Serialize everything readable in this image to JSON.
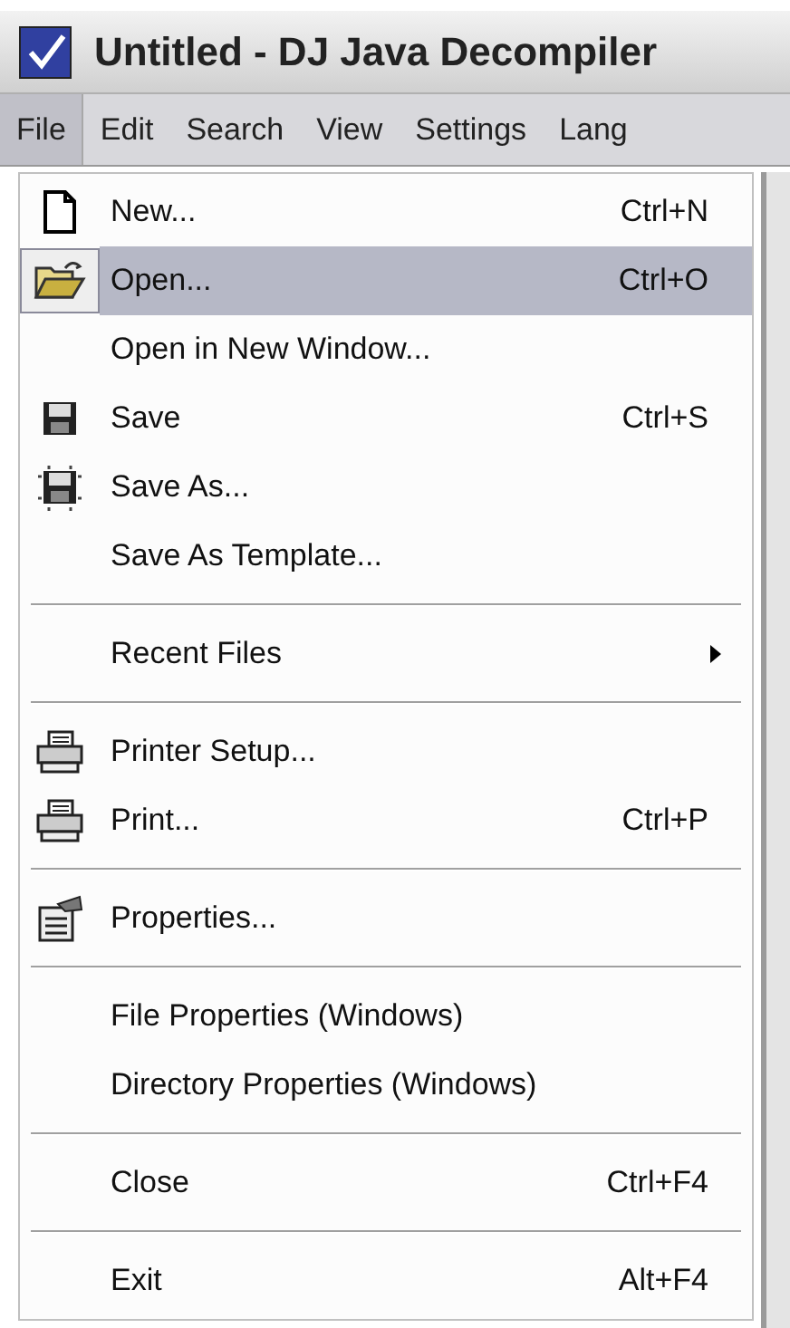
{
  "window": {
    "title": "Untitled - DJ Java Decompiler"
  },
  "menu_bar": [
    {
      "label": "File",
      "selected": true
    },
    {
      "label": "Edit",
      "selected": false
    },
    {
      "label": "Search",
      "selected": false
    },
    {
      "label": "View",
      "selected": false
    },
    {
      "label": "Settings",
      "selected": false
    },
    {
      "label": "Lang",
      "selected": false
    }
  ],
  "file_menu": [
    {
      "kind": "item",
      "label": "New...",
      "shortcut": "Ctrl+N",
      "selected": false
    },
    {
      "kind": "item",
      "label": "Open...",
      "shortcut": "Ctrl+O",
      "selected": true
    },
    {
      "kind": "item",
      "label": "Open in New Window...",
      "selected": false
    },
    {
      "kind": "item",
      "label": "Save",
      "shortcut": "Ctrl+S",
      "selected": false
    },
    {
      "kind": "item",
      "label": "Save As...",
      "selected": false
    },
    {
      "kind": "item",
      "label": "Save As Template...",
      "selected": false
    },
    {
      "kind": "separator"
    },
    {
      "kind": "submenu",
      "label": "Recent Files",
      "selected": false
    },
    {
      "kind": "separator"
    },
    {
      "kind": "item",
      "label": "Printer Setup...",
      "selected": false
    },
    {
      "kind": "item",
      "label": "Print...",
      "shortcut": "Ctrl+P",
      "selected": false
    },
    {
      "kind": "separator"
    },
    {
      "kind": "item",
      "label": "Properties...",
      "selected": false
    },
    {
      "kind": "separator"
    },
    {
      "kind": "item",
      "label": "File Properties (Windows)",
      "selected": false
    },
    {
      "kind": "item",
      "label": "Directory Properties (Windows)",
      "selected": false
    },
    {
      "kind": "separator"
    },
    {
      "kind": "item",
      "label": "Close",
      "shortcut": "Ctrl+F4",
      "selected": false
    },
    {
      "kind": "separator"
    },
    {
      "kind": "item",
      "label": "Exit",
      "shortcut": "Alt+F4",
      "selected": false
    }
  ]
}
